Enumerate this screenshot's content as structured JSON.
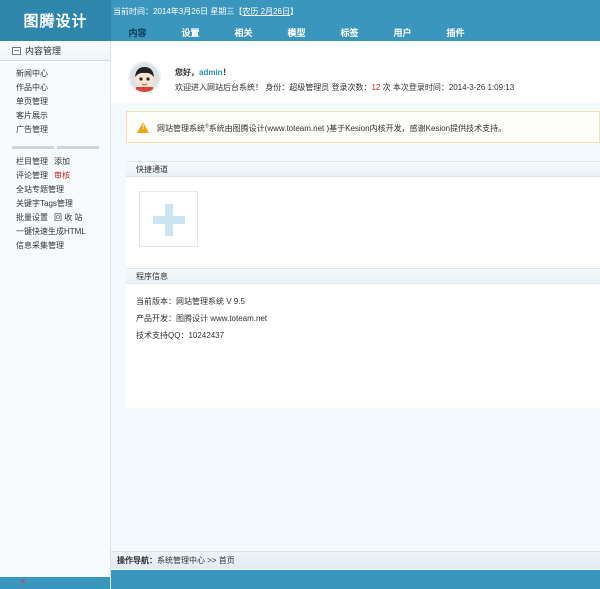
{
  "brand": {
    "name": "图腾设计"
  },
  "header": {
    "date_prefix": "当前时间：2014年3月26日 星期三【",
    "lunar_link": "农历 2月26日",
    "date_suffix": "】"
  },
  "nav": [
    "内容",
    "设置",
    "相关",
    "模型",
    "标签",
    "用户",
    "插件"
  ],
  "sidebar": {
    "title": "内容管理",
    "group1": [
      "新闻中心",
      "作品中心",
      "单页管理",
      "客片展示",
      "广告管理"
    ],
    "group2": {
      "column_label": "栏目管理",
      "column_add": "添加",
      "comment_label": "评论管理",
      "comment_review": "审核",
      "items": [
        "全站专题管理",
        "关键字Tags管理"
      ],
      "batch_label": "批量设置",
      "recycle": "回 收 站",
      "items2": [
        "一键快速生成HTML",
        "信息采集管理"
      ]
    },
    "bottom_icon": "close-x-icon"
  },
  "welcome": {
    "hello": "您好，",
    "user": "admin",
    "exclaim": "！",
    "line_a": "欢迎进入网站后台系统！ 身份：",
    "role": "超级管理员",
    "line_b": " 登录次数：",
    "login_count": "12",
    "line_c": " 次 本次登录时间：2014-3-26 1:09:13"
  },
  "notice": {
    "text_a": "网站管理系统",
    "sup": "®",
    "text_b": "系统由图腾设计(www.toteam.net )基于Kesion内核开发，感谢Kesion提供技术支持。",
    "icon": "warning-icon"
  },
  "quick": {
    "title": "快捷通道",
    "tile_icon": "plus-icon"
  },
  "program": {
    "title": "程序信息",
    "lines": [
      "当前版本：网站管理系统 V 9.5",
      "产品开发：图腾设计 www.toteam.net",
      "技术支持QQ：10242437"
    ]
  },
  "breadcrumb": {
    "label": "操作导航：",
    "item1": "系统管理中心",
    "sep": " >> ",
    "item2": "首页"
  }
}
